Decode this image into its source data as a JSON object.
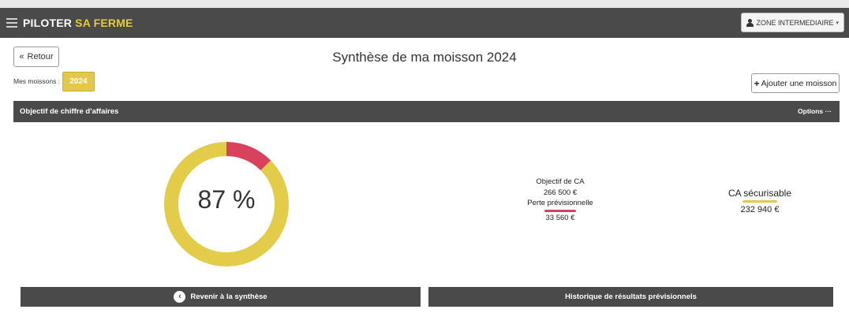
{
  "header": {
    "brand_main": "PILOTER",
    "brand_accent": "SA FERME",
    "zone_label": "ZONE INTERMEDIAIRE"
  },
  "nav": {
    "back_label": "Retour",
    "back_icon": "double-chevron-left-icon"
  },
  "page": {
    "title": "Synthèse de ma moisson 2024"
  },
  "moissons": {
    "label": "Mes moissons :",
    "selected_year": "2024",
    "add_label": "Ajouter une moisson"
  },
  "panel": {
    "title": "Objectif de chiffre d'affaires",
    "options_label": "Options ···"
  },
  "gauge": {
    "percent_text": "87 %",
    "secured_fraction": 0.874,
    "loss_fraction": 0.126,
    "secured_color": "#e3cc4a",
    "loss_color": "#d9425c"
  },
  "kpis": {
    "objectif_label": "Objectif de CA",
    "objectif_value": "266 500 €",
    "perte_label": "Perte prévisionnelle",
    "perte_value": "33 560 €",
    "ca_label": "CA sécurisable",
    "ca_value": "232 940 €"
  },
  "actions": {
    "back_to_summary": "Revenir à la synthèse",
    "history": "Historique de résultats prévisionnels"
  }
}
